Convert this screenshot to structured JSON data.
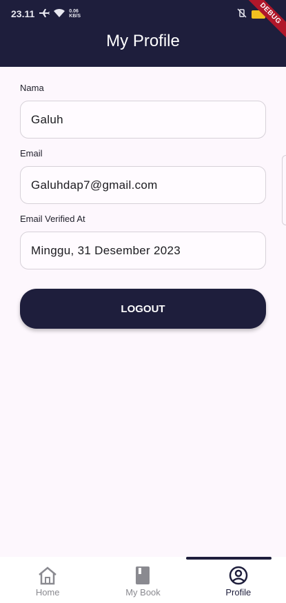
{
  "status": {
    "time": "23.11",
    "speed_top": "0.06",
    "speed_bottom": "KB/S",
    "debug": "DEBUG"
  },
  "app_bar": {
    "title": "My Profile"
  },
  "form": {
    "fields": [
      {
        "label": "Nama",
        "value": "Galuh"
      },
      {
        "label": "Email",
        "value": "Galuhdap7@gmail.com"
      },
      {
        "label": "Email Verified At",
        "value": "Minggu, 31 Desember 2023"
      }
    ]
  },
  "logout_label": "LOGOUT",
  "nav": {
    "items": [
      {
        "label": "Home",
        "icon": "home-icon"
      },
      {
        "label": "My Book",
        "icon": "book-icon"
      },
      {
        "label": "Profile",
        "icon": "account-circle-icon"
      }
    ],
    "active_index": 2
  },
  "colors": {
    "primary": "#1e1e3c",
    "background": "#fdf7fd",
    "debug": "#b0172a"
  }
}
